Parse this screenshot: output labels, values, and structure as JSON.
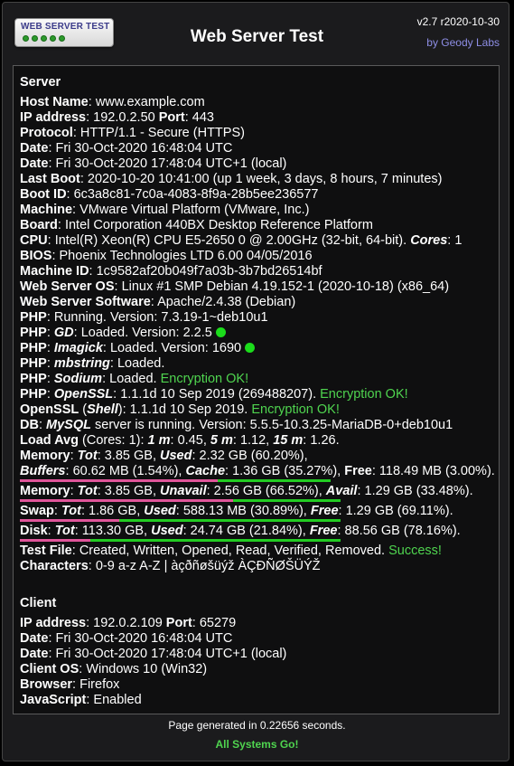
{
  "header": {
    "logo_text": "WEB SERVER TEST",
    "title": "Web Server Test",
    "version": "v2.7 r2020-10-30",
    "by": "by Geody Labs"
  },
  "server": {
    "heading": "Server",
    "host_label": "Host Name",
    "host": "www.example.com",
    "ip_label": "IP address",
    "ip": "192.0.2.50",
    "port_label": "Port",
    "port": "443",
    "protocol_label": "Protocol",
    "protocol": "HTTP/1.1 - Secure (HTTPS)",
    "date_label": "Date",
    "date_utc": "Fri 30-Oct-2020 16:48:04 UTC",
    "date_local": "Fri 30-Oct-2020 17:48:04 UTC+1 (local)",
    "lastboot_label": "Last Boot",
    "lastboot": "2020-10-20 10:41:00 (up 1 week, 3 days, 8 hours, 7 minutes)",
    "bootid_label": "Boot ID",
    "bootid": "6c3a8c81-7c0a-4083-8f9a-28b5ee236577",
    "machine_label": "Machine",
    "machine": "VMware Virtual Platform (VMware, Inc.)",
    "board_label": "Board",
    "board": "Intel Corporation 440BX Desktop Reference Platform",
    "cpu_label": "CPU",
    "cpu": "Intel(R) Xeon(R) CPU E5-2650 0 @ 2.00GHz (32-bit, 64-bit).",
    "cores_label": "Cores",
    "cores": "1",
    "bios_label": "BIOS",
    "bios": "Phoenix Technologies LTD 6.00 04/05/2016",
    "machineid_label": "Machine ID",
    "machineid": "1c9582af20b049f7a03b-3b7bd26514bf",
    "os_label": "Web Server OS",
    "os": "Linux #1 SMP Debian 4.19.152-1 (2020-10-18) (x86_64)",
    "software_label": "Web Server Software",
    "software": "Apache/2.4.38 (Debian)",
    "php_label": "PHP",
    "php": "Running. Version: 7.3.19-1~deb10u1",
    "gd_label": "GD",
    "gd": "Loaded. Version: 2.2.5",
    "imagick_label": "Imagick",
    "imagick": "Loaded. Version: 1690",
    "mbstring_label": "mbstring",
    "mbstring": "Loaded.",
    "sodium_label": "Sodium",
    "sodium": "Loaded.",
    "sodium_ok": "Encryption OK!",
    "openssl_label": "OpenSSL",
    "openssl": "1.1.1d 10 Sep 2019 (269488207).",
    "openssl_ok": "Encryption OK!",
    "openssl_shell_label": "OpenSSL",
    "shell_label": "Shell",
    "openssl_shell": "1.1.1d 10 Sep 2019.",
    "openssl_shell_ok": "Encryption OK!",
    "db_label": "DB",
    "mysql_label": "MySQL",
    "db": "server is running. Version: 5.5.5-10.3.25-MariaDB-0+deb10u1",
    "load_label": "Load Avg",
    "load_cores": "(Cores: 1):",
    "load_1m_label": "1 m",
    "load_1m": "0.45,",
    "load_5m_label": "5 m",
    "load_5m": "1.12,",
    "load_15m_label": "15 m",
    "load_15m": "1.26.",
    "memory_label": "Memory",
    "tot_label": "Tot",
    "used_label": "Used",
    "mem_tot": "3.85 GB,",
    "mem_used": "2.32 GB (60.20%),",
    "buffers_label": "Buffers",
    "buffers": "60.62 MB (1.54%),",
    "cache_label": "Cache",
    "cache": "1.36 GB (35.27%),",
    "free_label": "Free",
    "mem_free": "118.49 MB (3.00%).",
    "mem2_tot": "3.85 GB,",
    "unavail_label": "Unavail",
    "unavail": "2.56 GB (66.52%),",
    "avail_label": "Avail",
    "avail": "1.29 GB (33.48%).",
    "swap_label": "Swap",
    "swap_tot": "1.86 GB,",
    "swap_used": "588.13 MB (30.89%),",
    "swap_free": "1.29 GB (69.11%).",
    "disk_label": "Disk",
    "disk_tot": "113.30 GB,",
    "disk_used": "24.74 GB (21.84%),",
    "disk_free": "88.56 GB (78.16%).",
    "testfile_label": "Test File",
    "testfile": "Created, Written, Opened, Read, Verified, Removed.",
    "testfile_ok": "Success!",
    "chars_label": "Characters",
    "chars": "0-9 a-z A-Z | àçðñøšüýž ÀÇĐÑØŠÜÝŽ",
    "mem_used_pct": 60.2,
    "buffers_pct": 1.54,
    "cache_pct": 35.27,
    "mem_free_pct": 3.0,
    "unavail_pct": 66.52,
    "swap_used_pct": 30.89,
    "disk_used_pct": 21.84
  },
  "client": {
    "heading": "Client",
    "ip_label": "IP address",
    "ip": "192.0.2.109",
    "port_label": "Port",
    "port": "65279",
    "date_label": "Date",
    "date_utc": "Fri 30-Oct-2020 16:48:04 UTC",
    "date_local": "Fri 30-Oct-2020 17:48:04 UTC+1 (local)",
    "os_label": "Client OS",
    "os": "Windows 10 (Win32)",
    "browser_label": "Browser",
    "browser": "Firefox",
    "js_label": "JavaScript",
    "js": "Enabled"
  },
  "footer": {
    "generated": "Page generated in 0.22656 seconds.",
    "status": "All Systems Go!"
  },
  "colors": {
    "ok": "#4fd44f",
    "used_bar": "#e0559a",
    "free_bar": "#22cc22",
    "link": "#8e8ee6"
  }
}
